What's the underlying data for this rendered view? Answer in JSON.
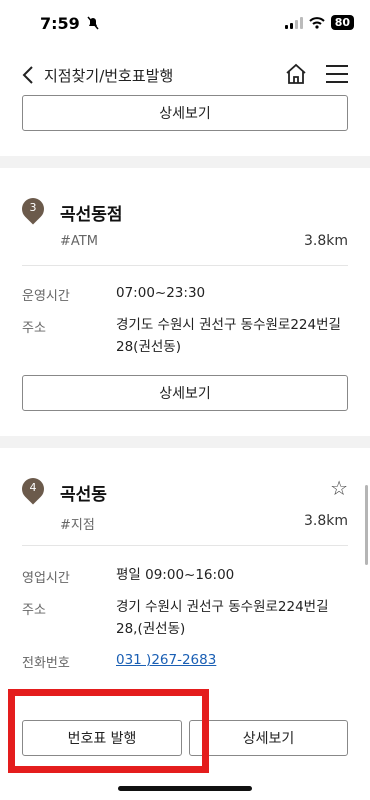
{
  "status": {
    "time": "7:59",
    "battery": "80"
  },
  "nav": {
    "title": "지점찾기/번호표발행"
  },
  "top": {
    "detail_label": "상세보기"
  },
  "branches": [
    {
      "index": "3",
      "name": "곡선동점",
      "tag": "#ATM",
      "distance": "3.8km",
      "hours_label": "운영시간",
      "hours": "07:00~23:30",
      "address_label": "주소",
      "address": "경기도 수원시 권선구 동수원로224번길 28(권선동)",
      "detail_label": "상세보기"
    },
    {
      "index": "4",
      "name": "곡선동",
      "tag": "#지점",
      "distance": "3.8km",
      "hours_label": "영업시간",
      "hours": "평일 09:00~16:00",
      "address_label": "주소",
      "address": "경기 수원시 권선구 동수원로224번길 28,(권선동)",
      "phone_label": "전화번호",
      "phone": "031 )267-2683",
      "ticket_label": "번호표 발행",
      "detail_label": "상세보기"
    }
  ],
  "colors": {
    "highlight": "#e41d1d",
    "pin": "#6b5a4b",
    "link": "#1a5fb4"
  }
}
